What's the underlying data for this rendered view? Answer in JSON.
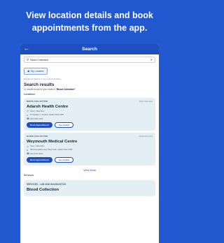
{
  "headline": "View location details and book appointments from the app.",
  "appbar": {
    "title": "Search",
    "back_icon": "arrow-left-icon"
  },
  "search": {
    "value": "Blood Collection",
    "clear_icon": "close-icon"
  },
  "location_chip": {
    "label": "My Location"
  },
  "note": "Results are based on your current location",
  "results": {
    "title": "Search results",
    "count_text": "11 results found for your search ",
    "query": "\"Blood Collection\"",
    "locations_label": "Locations"
  },
  "locations": [
    {
      "type": "NORTH COLLECTION",
      "distance": "10 km from here",
      "name": "Adarsh Health Centre",
      "hours": "Open • 8am-5pm",
      "address": "12 Agway Ln, Angami, Nation Park 2000",
      "phone": "(02) 9400 1422",
      "book_label": "Book Appointment",
      "details_label": "See Details"
    },
    {
      "type": "BLOOD COLLECTION",
      "distance": "12 km from here",
      "name": "Weymouth Medical Centre",
      "hours": "Open • 8am-5pm",
      "address": "309 Evangeline Hwy Weymouth, Nation Park 2000",
      "phone": "(02) 9473 4212",
      "book_label": "Book Appointment",
      "details_label": "See Details"
    }
  ],
  "view_more": "View More",
  "services": {
    "label": "Services",
    "category": "SERVICES - LAB AND DIAGNOSTICS",
    "name": "Blood Collection"
  }
}
